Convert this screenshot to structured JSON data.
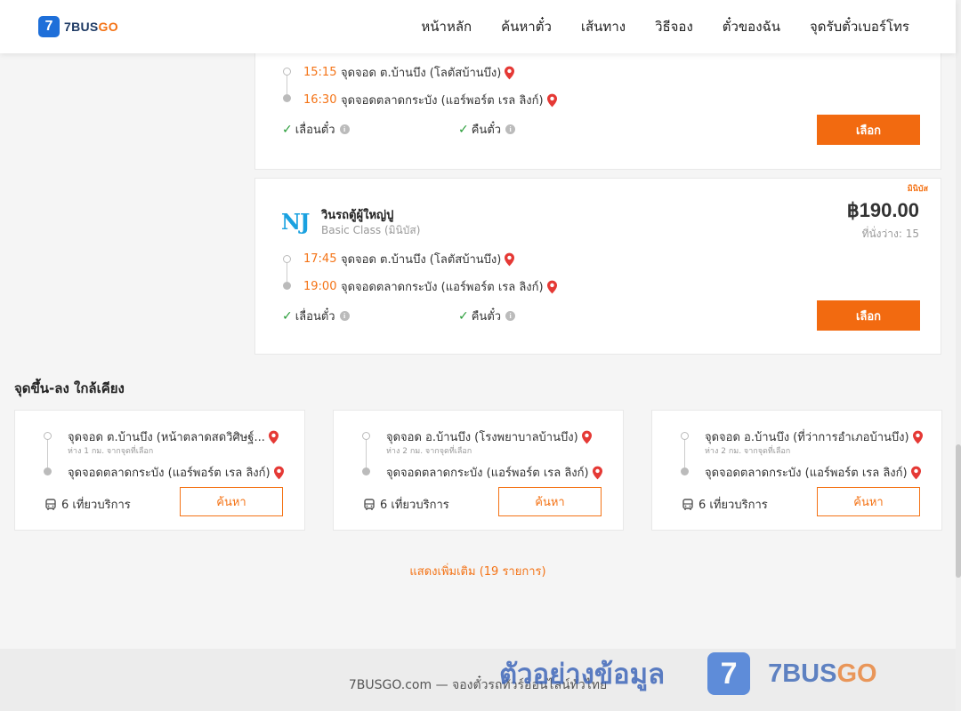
{
  "header": {
    "logo_badge": "7",
    "logo_brand_a": "7BUS",
    "logo_brand_b": "GO",
    "nav": [
      "หน้าหลัก",
      "ค้นหาตั๋ว",
      "เส้นทาง",
      "วิธีจอง",
      "ตั๋วของฉัน",
      "จุดรับตั๋วเบอร์โทร"
    ]
  },
  "trips": [
    {
      "stops": [
        {
          "time": "15:15",
          "name": "จุดจอด ต.บ้านบึง (โลตัสบ้านบึง)"
        },
        {
          "time": "16:30",
          "name": "จุดจอดตลาดกระบัง (แอร์พอร์ต เรล ลิงก์)"
        }
      ],
      "features": [
        "เลื่อนตั๋ว",
        "คืนตั๋ว"
      ],
      "select_label": "เลือก"
    },
    {
      "tag": "มินิบัส",
      "operator_logo": "NJ",
      "operator_name": "วินรถตู้ผู้ใหญ่ปู",
      "operator_class": "Basic Class (มินิบัส)",
      "price": "฿190.00",
      "seats": "ที่นั่งว่าง: 15",
      "stops": [
        {
          "time": "17:45",
          "name": "จุดจอด ต.บ้านบึง (โลตัสบ้านบึง)"
        },
        {
          "time": "19:00",
          "name": "จุดจอดตลาดกระบัง (แอร์พอร์ต เรล ลิงก์)"
        }
      ],
      "features": [
        "เลื่อนตั๋ว",
        "คืนตั๋ว"
      ],
      "select_label": "เลือก"
    }
  ],
  "nearby": {
    "title": "จุดขึ้น-ลง ใกล้เคียง",
    "items": [
      {
        "from": "จุดจอด ต.บ้านบึง (หน้าตลาดสดวิศิษฐ์...",
        "distance": "ห่าง 1 กม. จากจุดที่เลือก",
        "to": "จุดจอดตลาดกระบัง (แอร์พอร์ต เรล ลิงก์)",
        "trips": "6 เที่ยวบริการ",
        "search_label": "ค้นหา"
      },
      {
        "from": "จุดจอด อ.บ้านบึง (โรงพยาบาลบ้านบึง)",
        "distance": "ห่าง 2 กม. จากจุดที่เลือก",
        "to": "จุดจอดตลาดกระบัง (แอร์พอร์ต เรล ลิงก์)",
        "trips": "6 เที่ยวบริการ",
        "search_label": "ค้นหา"
      },
      {
        "from": "จุดจอด อ.บ้านบึง (ที่ว่าการอำเภอบ้านบึง)",
        "distance": "ห่าง 2 กม. จากจุดที่เลือก",
        "to": "จุดจอดตลาดกระบัง (แอร์พอร์ต เรล ลิงก์)",
        "trips": "6 เที่ยวบริการ",
        "search_label": "ค้นหา"
      }
    ],
    "show_more": "แสดงเพิ่มเติม (19 รายการ)"
  },
  "footer": {
    "text": "7BUSGO.com — จองตั๋วรถทัวร์ออนไลน์ทั่วไทย"
  },
  "watermark": {
    "text": "ตัวอย่างข้อมูล",
    "badge": "7",
    "brand_a": "7BUS",
    "brand_b": "GO"
  },
  "colors": {
    "accent": "#f26a10",
    "brand_blue": "#1e6fd9",
    "check_green": "#2a9d3a"
  }
}
